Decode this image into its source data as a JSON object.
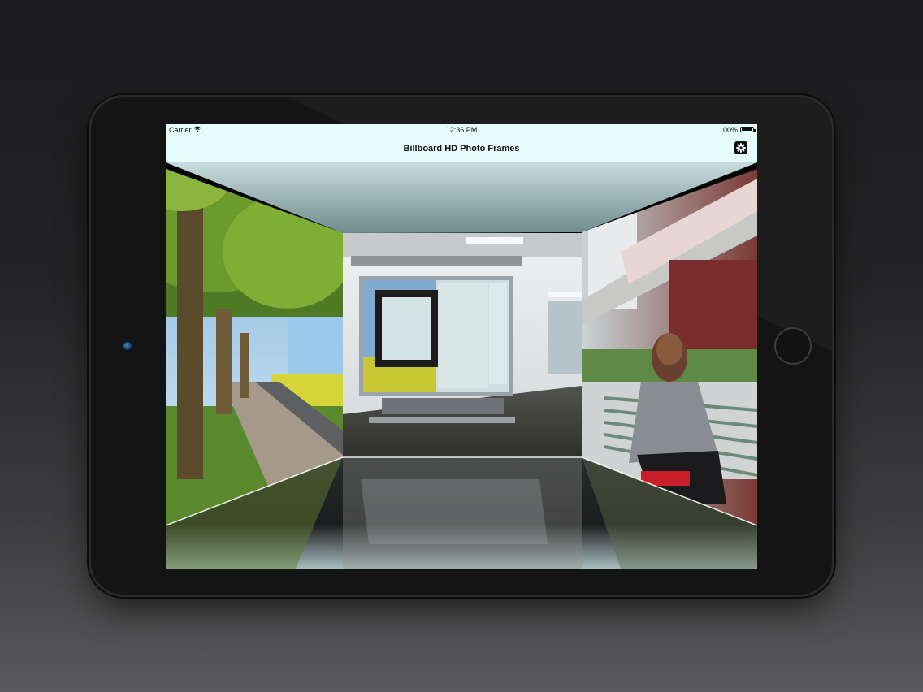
{
  "status_bar": {
    "carrier": "Carrier",
    "time": "12:36 PM",
    "battery": "100%",
    "icons": [
      "wifi-icon",
      "battery-icon"
    ]
  },
  "nav_bar": {
    "title": "Billboard HD Photo Frames",
    "settings_icon": "gear-icon"
  },
  "gallery": {
    "panels": [
      {
        "position": "left",
        "subject": "tree-lined road"
      },
      {
        "position": "center",
        "subject": "office wall with billboard photo frame"
      },
      {
        "position": "right",
        "subject": "woman seated on bench"
      }
    ]
  },
  "colors": {
    "bar_background": "#e6fbfb",
    "bezel": "#141415",
    "background_top": "#1b1b1d",
    "background_bottom": "#5a5a5c"
  }
}
